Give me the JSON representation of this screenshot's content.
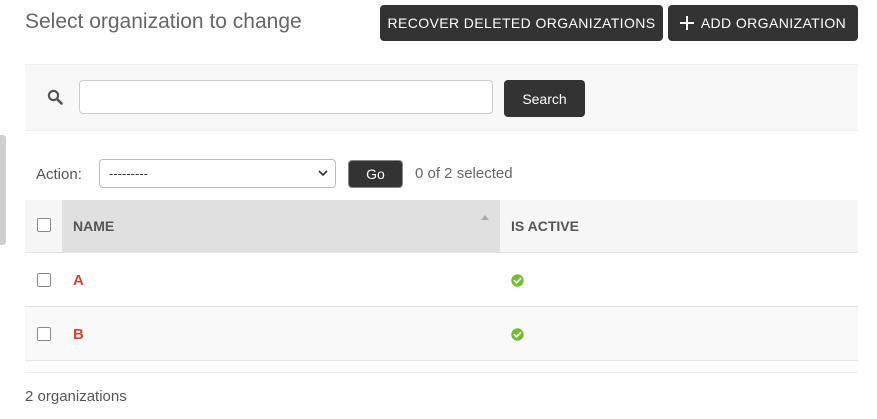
{
  "header": {
    "title": "Select organization to change",
    "recover_label": "RECOVER DELETED ORGANIZATIONS",
    "add_label": "ADD ORGANIZATION"
  },
  "search": {
    "value": "",
    "button_label": "Search"
  },
  "actions": {
    "label": "Action:",
    "selected_option": "---------",
    "go_label": "Go",
    "selected_count": "0 of 2 selected"
  },
  "table": {
    "columns": [
      "NAME",
      "IS ACTIVE"
    ],
    "rows": [
      {
        "name": "A",
        "is_active": true
      },
      {
        "name": "B",
        "is_active": true
      }
    ]
  },
  "paginator": {
    "text": "2 organizations"
  },
  "colors": {
    "accent_link": "#d6452b",
    "button_dark": "#333333",
    "active_green": "#70bf2b"
  },
  "icons": {
    "search": "search-icon",
    "add": "plus-icon",
    "active": "check-circle-icon",
    "select": "chevron-down-icon"
  }
}
